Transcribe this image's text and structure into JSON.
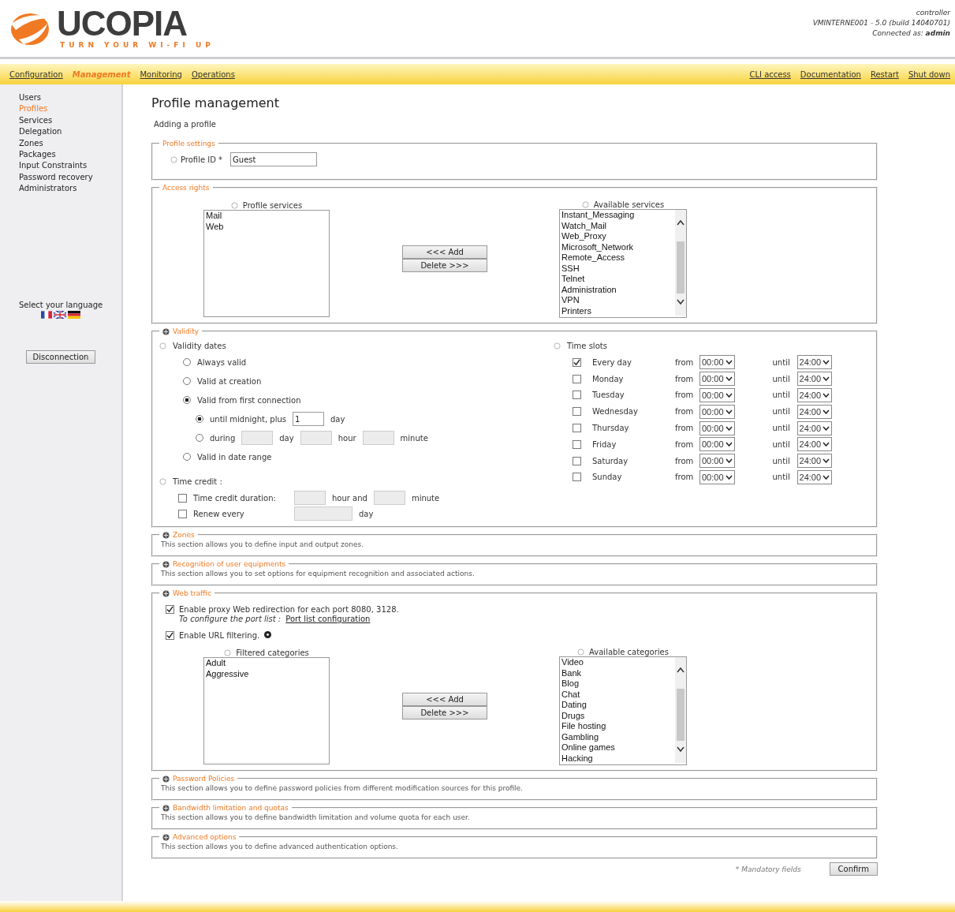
{
  "header": {
    "logo_name": "UCOPIA",
    "logo_tagline": "TURN YOUR WI-FI UP",
    "info": [
      "controller",
      "VMINTERNE001  -  5.0 (build 14040701)",
      "Connected as: **admin**"
    ]
  },
  "nav": {
    "left": [
      {
        "label": "Configuration",
        "selected": false
      },
      {
        "label": "Management",
        "selected": true
      },
      {
        "label": "Monitoring",
        "selected": false
      },
      {
        "label": "Operations",
        "selected": false
      }
    ],
    "right": [
      "CLI access",
      "Documentation",
      "Restart",
      "Shut down"
    ]
  },
  "sidebar": {
    "items": [
      {
        "label": "Users",
        "selected": false
      },
      {
        "label": "Profiles",
        "selected": true
      },
      {
        "label": "Services",
        "selected": false
      },
      {
        "label": "Delegation",
        "selected": false
      },
      {
        "label": "Zones",
        "selected": false
      },
      {
        "label": "Packages",
        "selected": false
      },
      {
        "label": "Input Constraints",
        "selected": false
      },
      {
        "label": "Password recovery",
        "selected": false
      },
      {
        "label": "Administrators",
        "selected": false
      }
    ],
    "language_label": "Select your language",
    "disconnect_button": "Disconnection"
  },
  "page": {
    "title": "Profile management",
    "subtitle": "Adding a profile"
  },
  "sections": [
    {
      "kind": "profile",
      "legend": "Profile settings",
      "collapsible": false,
      "label": "Profile ID *",
      "value": "Guest"
    },
    {
      "kind": "access",
      "legend": "Access rights",
      "collapsible": false,
      "transfer": {
        "selected_label": "Profile services",
        "selected_items": [
          "Mail",
          "Web"
        ],
        "available_label": "Available services",
        "available_items": [
          "Instant_Messaging",
          "Watch_Mail",
          "Web_Proxy",
          "Microsoft_Network",
          "Remote_Access",
          "SSH",
          "Telnet",
          "Administration",
          "VPN",
          "Printers"
        ],
        "add_button": "<<< Add",
        "delete_button": "Delete >>>"
      }
    },
    {
      "kind": "validity",
      "legend": "Validity",
      "collapsible": true,
      "dates_label": "Validity dates",
      "date_options": [
        {
          "label": "Always valid",
          "selected": false
        },
        {
          "label": "Valid at creation",
          "selected": false
        },
        {
          "label": "Valid from first connection",
          "selected": true,
          "children": [
            {
              "kind": "plus",
              "label": "until midnight, plus",
              "value": "1",
              "unit": "day",
              "selected": true
            },
            {
              "kind": "during",
              "label": "during",
              "units": [
                "day",
                "hour",
                "minute"
              ],
              "selected": false
            }
          ]
        },
        {
          "label": "Valid in date range",
          "selected": false
        }
      ],
      "credit_label": "Time credit :",
      "credit_options": [
        {
          "label": "Time credit duration:",
          "checked": false,
          "units": [
            "hour and",
            "minute"
          ]
        },
        {
          "label": "Renew every",
          "checked": false,
          "units": [
            "day"
          ]
        }
      ],
      "slots_label": "Time slots",
      "slots": [
        {
          "day": "Every day",
          "checked": true,
          "from_label": "from",
          "from": "00:00",
          "until_label": "until",
          "until": "24:00"
        },
        {
          "day": "Monday",
          "checked": false,
          "from_label": "from",
          "from": "00:00",
          "until_label": "until",
          "until": "24:00"
        },
        {
          "day": "Tuesday",
          "checked": false,
          "from_label": "from",
          "from": "00:00",
          "until_label": "until",
          "until": "24:00"
        },
        {
          "day": "Wednesday",
          "checked": false,
          "from_label": "from",
          "from": "00:00",
          "until_label": "until",
          "until": "24:00"
        },
        {
          "day": "Thursday",
          "checked": false,
          "from_label": "from",
          "from": "00:00",
          "until_label": "until",
          "until": "24:00"
        },
        {
          "day": "Friday",
          "checked": false,
          "from_label": "from",
          "from": "00:00",
          "until_label": "until",
          "until": "24:00"
        },
        {
          "day": "Saturday",
          "checked": false,
          "from_label": "from",
          "from": "00:00",
          "until_label": "until",
          "until": "24:00"
        },
        {
          "day": "Sunday",
          "checked": false,
          "from_label": "from",
          "from": "00:00",
          "until_label": "until",
          "until": "24:00"
        }
      ]
    },
    {
      "kind": "note",
      "legend": "Zones",
      "collapsible": true,
      "description": "This section allows you to define input and output zones."
    },
    {
      "kind": "note",
      "legend": "Recognition of user equipments",
      "collapsible": true,
      "description": "This section allows you to set options for equipment recognition and associated actions."
    },
    {
      "kind": "web",
      "legend": "Web traffic",
      "collapsible": true,
      "proxy": {
        "checked": true,
        "label": "Enable proxy Web redirection for each port 8080, 3128.",
        "note": "To configure the port list :",
        "link": "Port list configuration"
      },
      "url_filter": {
        "checked": true,
        "label": "Enable URL filtering."
      },
      "transfer": {
        "selected_label": "Filtered categories",
        "selected_items": [
          "Adult",
          "Aggressive"
        ],
        "available_label": "Available categories",
        "available_items": [
          "Video",
          "Bank",
          "Blog",
          "Chat",
          "Dating",
          "Drugs",
          "File hosting",
          "Gambling",
          "Online games",
          "Hacking"
        ],
        "add_button": "<<< Add",
        "delete_button": "Delete >>>"
      }
    },
    {
      "kind": "note",
      "legend": "Password Policies",
      "collapsible": true,
      "description": "This section allows you to define password policies from different modification sources for this profile."
    },
    {
      "kind": "note",
      "legend": "Bandwidth limitation and quotas",
      "collapsible": true,
      "description": "This section allows you to define bandwidth limitation and volume quota for each user."
    },
    {
      "kind": "note",
      "legend": "Advanced options",
      "collapsible": true,
      "description": "This section allows you to define advanced authentication options."
    }
  ],
  "footer": {
    "note": "* Mandatory fields",
    "confirm_button": "Confirm"
  }
}
